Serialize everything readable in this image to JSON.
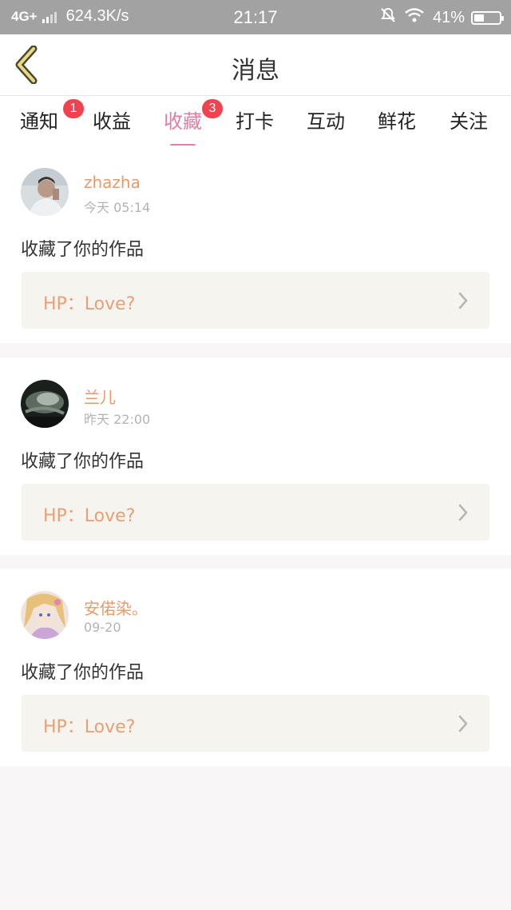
{
  "status_bar": {
    "network": "4G+",
    "speed": "624.3K/s",
    "time": "21:17",
    "battery": "41%"
  },
  "header": {
    "title": "消息"
  },
  "tabs": [
    {
      "label": "通知",
      "badge": "1"
    },
    {
      "label": "收益"
    },
    {
      "label": "收藏",
      "badge": "3",
      "active": true
    },
    {
      "label": "打卡"
    },
    {
      "label": "互动"
    },
    {
      "label": "鲜花"
    },
    {
      "label": "关注"
    }
  ],
  "messages": [
    {
      "user": "zhazha",
      "time": "今天 05:14",
      "action": "收藏了你的作品",
      "work": "HP：Love?"
    },
    {
      "user": "兰儿",
      "time": "昨天 22:00",
      "action": "收藏了你的作品",
      "work": "HP：Love?"
    },
    {
      "user": "安偌染。",
      "time": "09-20",
      "action": "收藏了你的作品",
      "work": "HP：Love?"
    }
  ],
  "colors": {
    "accent": "#e27ea4",
    "username": "#e89a6b",
    "badge": "#f2414f",
    "work_bg": "#f5f4ee"
  }
}
